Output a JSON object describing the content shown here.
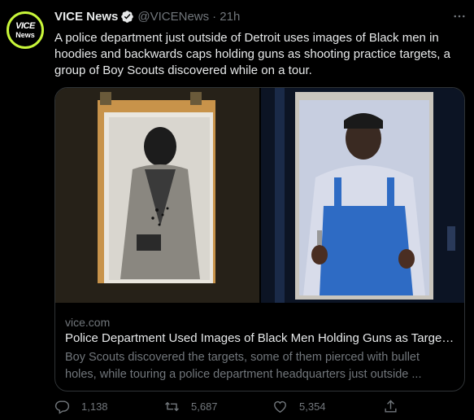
{
  "author": {
    "name": "VICE News",
    "handle": "@VICENews",
    "time": "· 21h",
    "avatar_line1": "VICE",
    "avatar_line2": "News"
  },
  "tweet_text": "A police department just outside of Detroit uses images of Black men in hoodies and backwards caps holding guns as shooting practice targets, a group of Boy Scouts discovered while on a tour.",
  "card": {
    "domain": "vice.com",
    "title": "Police Department Used Images of Black Men Holding Guns as Target ...",
    "description": "Boy Scouts discovered the targets, some of them pierced with bullet holes, while touring a police department headquarters just outside ..."
  },
  "actions": {
    "replies": "1,138",
    "retweets": "5,687",
    "likes": "5,354"
  },
  "colors": {
    "background": "#000000",
    "text": "#e7e9ea",
    "muted": "#71767b",
    "verified": "#1d9bf0",
    "avatar_ring": "#c8f63a"
  }
}
